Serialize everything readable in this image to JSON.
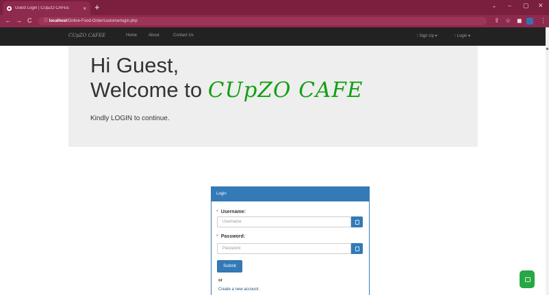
{
  "browser": {
    "tab_title": "Guest Login | CUpZO CAFEE",
    "tab_close": "×",
    "new_tab": "+",
    "url_host": "localhost",
    "url_path": "/Online-Food-Order/customerlogin.php",
    "back": "←",
    "forward": "→",
    "reload": "C",
    "window_minimize": "–",
    "window_restore": "▢",
    "window_close": "✕"
  },
  "navbar": {
    "brand": "CUpZO CAFEE",
    "links": [
      "Home",
      "About",
      "Contact Us"
    ],
    "signup": "Sign Up",
    "login": "Login"
  },
  "jumbotron": {
    "greeting": "Hi Guest,",
    "welcome_prefix": "Welcome to ",
    "cafe_name": "CUpZO CAFE",
    "subtitle": "Kindly LOGIN to continue."
  },
  "login_panel": {
    "heading": "Login",
    "username_label": "Username:",
    "username_placeholder": "Username",
    "password_label": "Password:",
    "password_placeholder": "Password",
    "required_mark": "*",
    "submit": "Submit",
    "or": "or",
    "create_account": "Create a new account."
  },
  "colors": {
    "chrome": "#7a1f3d",
    "navbar": "#222222",
    "panel_primary": "#337ab7",
    "cafe_green": "#12a012",
    "chat_button": "#28a745"
  }
}
